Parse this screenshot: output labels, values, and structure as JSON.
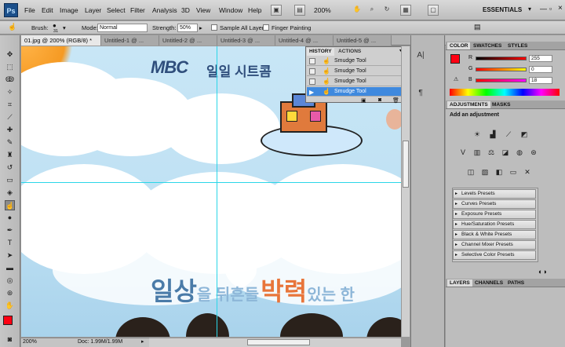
{
  "app": {
    "logo": "Ps"
  },
  "menu": [
    "File",
    "Edit",
    "Image",
    "Layer",
    "Select",
    "Filter",
    "Analysis",
    "3D",
    "View",
    "Window",
    "Help"
  ],
  "menubar": {
    "zoom": "200%",
    "workspace": "ESSENTIALS"
  },
  "options": {
    "brush_label": "Brush:",
    "brush_size": "31",
    "mode_label": "Mode:",
    "mode_value": "Normal",
    "strength_label": "Strength:",
    "strength_value": "50%",
    "sample_all_layers": "Sample All Layers",
    "finger_painting": "Finger Painting"
  },
  "tabs": [
    "01.jpg @ 200% (RGB/8) *",
    "Untitled-1 @ ...",
    "Untitled-2 @ ...",
    "Untitled-3 @ ...",
    "Untitled-4 @ ...",
    "Untitled-5 @ ..."
  ],
  "canvas": {
    "logo_text": "MBC",
    "show_title": "일일 시트콤",
    "tagline_a": "일상",
    "tagline_b": "을 뒤흔들",
    "tagline_c": "박력",
    "tagline_d": "있는 한"
  },
  "history": {
    "tab_history": "HISTORY",
    "tab_actions": "ACTIONS",
    "rows": [
      "Smudge Tool",
      "Smudge Tool",
      "Smudge Tool",
      "Smudge Tool"
    ]
  },
  "color_panel": {
    "tabs": [
      "COLOR",
      "SWATCHES",
      "STYLES"
    ],
    "r_label": "R",
    "r_value": "255",
    "g_label": "G",
    "g_value": "0",
    "b_label": "B",
    "b_value": "18",
    "foreground": "#ff0012"
  },
  "adjustments": {
    "tabs": [
      "ADJUSTMENTS",
      "MASKS"
    ],
    "prompt": "Add an adjustment",
    "presets": [
      "Levels Presets",
      "Curves Presets",
      "Exposure Presets",
      "Hue/Saturation Presets",
      "Black & White Presets",
      "Channel Mixer Presets",
      "Selective Color Presets"
    ]
  },
  "layers_panel": {
    "tabs": [
      "LAYERS",
      "CHANNELS",
      "PATHS"
    ]
  },
  "status": {
    "zoom": "200%",
    "doc": "Doc: 1.99M/1.99M"
  }
}
